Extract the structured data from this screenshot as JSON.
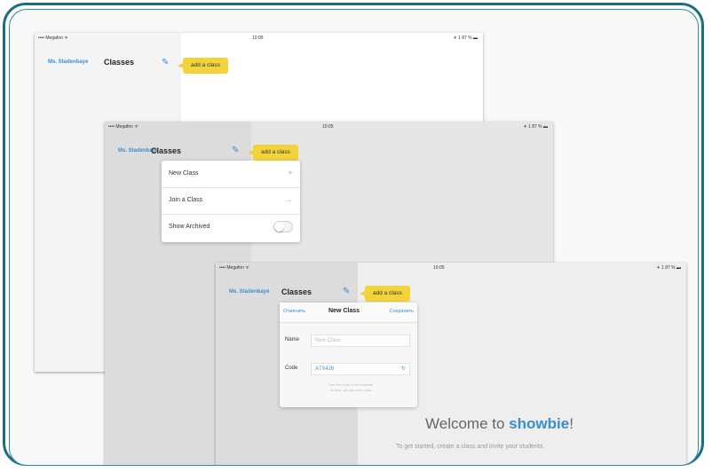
{
  "status_bar": {
    "carrier": "•••• Megafon ᯤ",
    "time": "10:05",
    "battery": "✈ 1 87 % ▬"
  },
  "header": {
    "teacher_name": "Ms. Stadenbaye",
    "title": "Classes",
    "add_tag": "add a class"
  },
  "menu": {
    "items": [
      {
        "label": "New Class",
        "icon": "+"
      },
      {
        "label": "Join a Class",
        "icon": "→"
      },
      {
        "label": "Show Archived",
        "icon": ""
      }
    ]
  },
  "new_class_form": {
    "cancel": "Отменить",
    "title": "New Class",
    "save": "Сохранить",
    "name_label": "Name",
    "name_placeholder": "New Class",
    "code_label": "Code",
    "code_value": "A7X4J8",
    "hint_line1": "Use this code to let students",
    "hint_line2": "do they can join your class"
  },
  "welcome": {
    "prefix": "Welcome to ",
    "brand": "showbie",
    "suffix": "!",
    "subtitle": "To get started, create a class and invite your students."
  },
  "colors": {
    "frame": "#1c6d80",
    "accent": "#3a8fc9",
    "tag": "#f2d33c"
  }
}
